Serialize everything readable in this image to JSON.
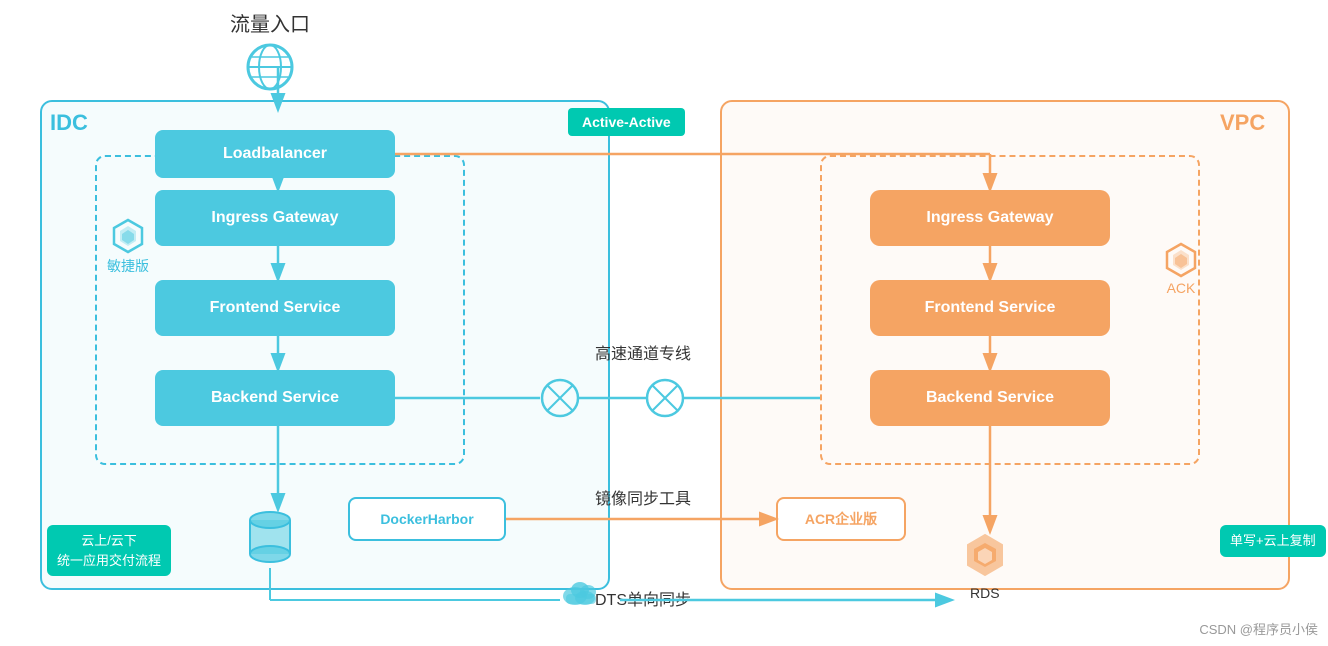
{
  "traffic": {
    "label": "流量入口"
  },
  "idc": {
    "label": "IDC"
  },
  "vpc": {
    "label": "VPC"
  },
  "active_active": {
    "label": "Active-Active"
  },
  "idc_services": {
    "loadbalancer": "Loadbalancer",
    "ingress": "Ingress Gateway",
    "frontend": "Frontend Service",
    "backend": "Backend Service"
  },
  "vpc_services": {
    "ingress": "Ingress Gateway",
    "frontend": "Frontend Service",
    "backend": "Backend Service"
  },
  "labels": {
    "express_line": "高速通道专线",
    "mirror_sync": "镜像同步工具",
    "dts_sync": "DTS单向同步",
    "agile": "敏捷版",
    "ack": "ACK",
    "docker_harbor": "DockerHarbor",
    "acr": "ACR企业版",
    "rds": "RDS",
    "cloud_tag_line1": "云上/云下",
    "cloud_tag_line2": "统一应用交付流程",
    "write_tag": "单写+云上复制",
    "watermark": "CSDN @程序员小侯"
  }
}
